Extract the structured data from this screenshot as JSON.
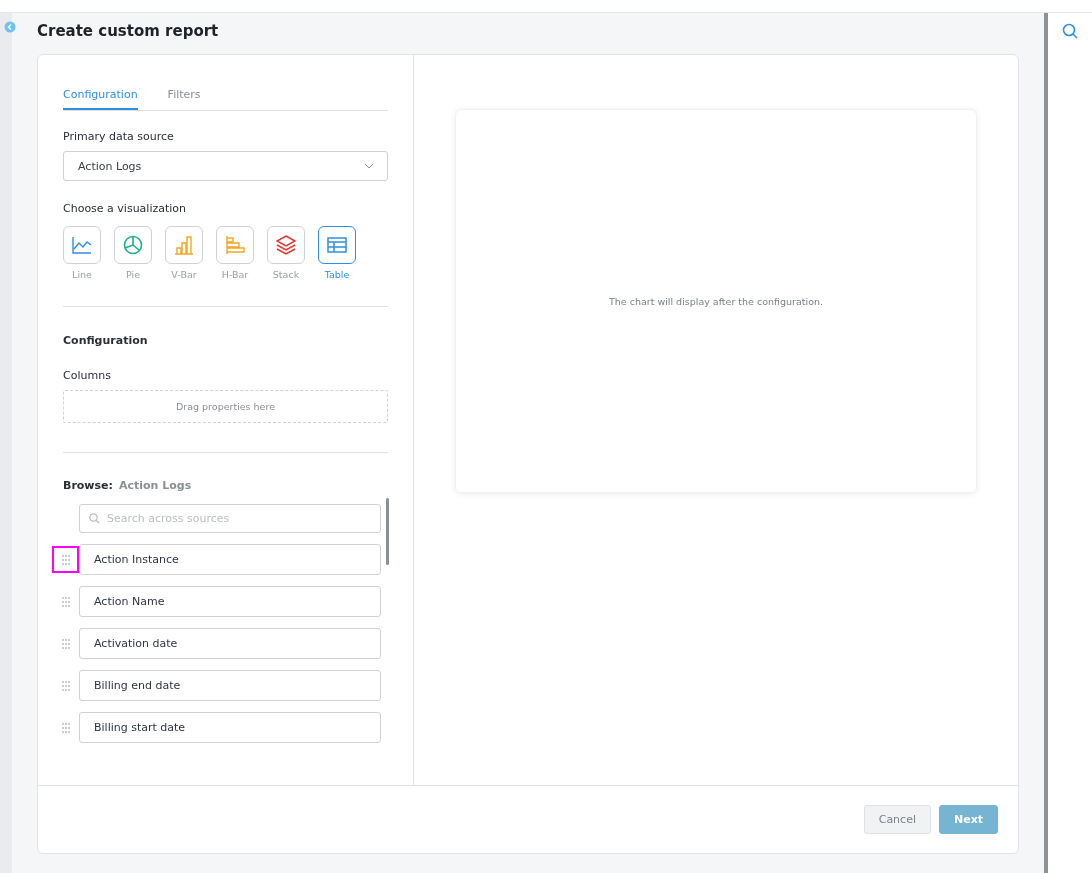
{
  "page": {
    "title": "Create custom report"
  },
  "tabs": [
    {
      "label": "Configuration",
      "selected": true
    },
    {
      "label": "Filters",
      "selected": false
    }
  ],
  "primary_data_source": {
    "label": "Primary data source",
    "value": "Action Logs"
  },
  "visualization": {
    "label": "Choose a visualization",
    "options": [
      {
        "kind": "line",
        "label": "Line",
        "selected": false
      },
      {
        "kind": "pie",
        "label": "Pie",
        "selected": false
      },
      {
        "kind": "vbar",
        "label": "V-Bar",
        "selected": false
      },
      {
        "kind": "hbar",
        "label": "H-Bar",
        "selected": false
      },
      {
        "kind": "stack",
        "label": "Stack",
        "selected": false
      },
      {
        "kind": "table",
        "label": "Table",
        "selected": true
      }
    ]
  },
  "configuration": {
    "heading": "Configuration",
    "columns_label": "Columns",
    "drop_zone": "Drag properties here"
  },
  "browse": {
    "label": "Browse:",
    "source": "Action Logs",
    "search": {
      "placeholder": "Search across sources"
    },
    "properties": [
      {
        "name": "Action Instance",
        "highlighted": true
      },
      {
        "name": "Action Name",
        "highlighted": false
      },
      {
        "name": "Activation date",
        "highlighted": false
      },
      {
        "name": "Billing end date",
        "highlighted": false
      },
      {
        "name": "Billing start date",
        "highlighted": false
      }
    ]
  },
  "preview": {
    "message": "The chart will display after the configuration."
  },
  "buttons": [
    {
      "kind": "secondary",
      "label": "Cancel"
    },
    {
      "kind": "primary",
      "label": "Next"
    }
  ]
}
